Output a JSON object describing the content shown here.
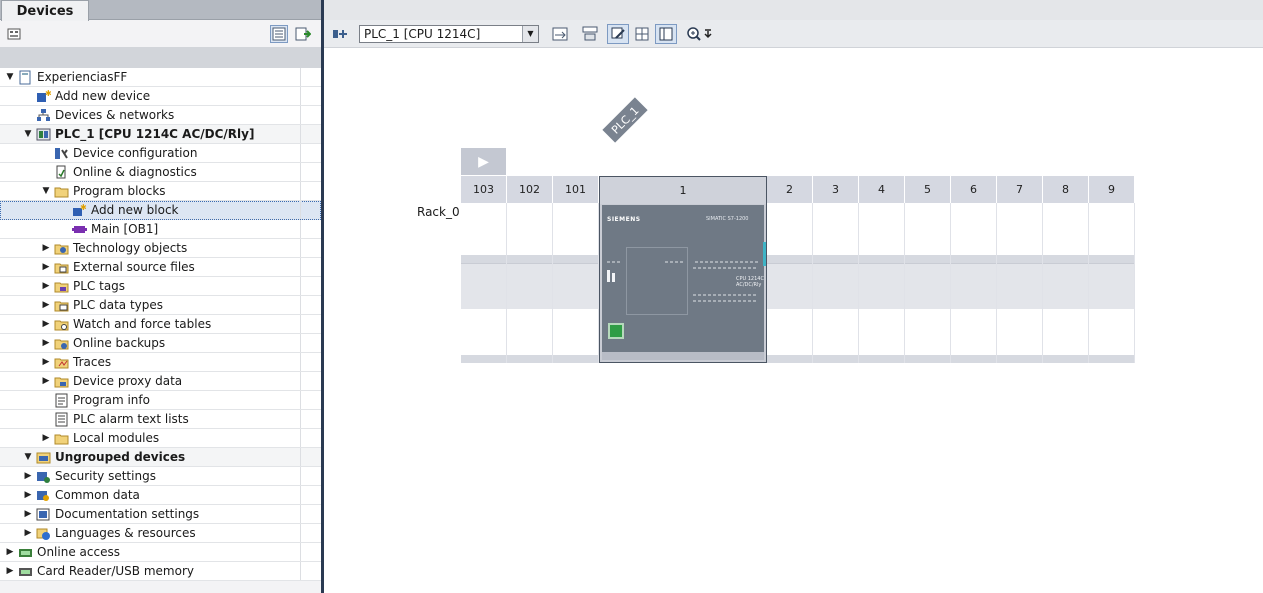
{
  "left_pane": {
    "tab_label": "Devices",
    "tree": [
      {
        "label": "ExperienciasFF",
        "indent": 0,
        "expander": "open",
        "icon": "project-icon",
        "bold": false
      },
      {
        "label": "Add new device",
        "indent": 1,
        "expander": "none",
        "icon": "add-device-icon",
        "bold": false
      },
      {
        "label": "Devices & networks",
        "indent": 1,
        "expander": "none",
        "icon": "network-icon",
        "bold": false
      },
      {
        "label": "PLC_1 [CPU 1214C AC/DC/Rly]",
        "indent": 1,
        "expander": "open",
        "icon": "plc-icon",
        "bold": true
      },
      {
        "label": "Device configuration",
        "indent": 2,
        "expander": "none",
        "icon": "device-config-icon",
        "bold": false
      },
      {
        "label": "Online & diagnostics",
        "indent": 2,
        "expander": "none",
        "icon": "diagnostics-icon",
        "bold": false
      },
      {
        "label": "Program blocks",
        "indent": 2,
        "expander": "open",
        "icon": "folder-icon",
        "bold": false
      },
      {
        "label": "Add new block",
        "indent": 3,
        "expander": "none",
        "icon": "add-block-icon",
        "bold": false,
        "selected": true
      },
      {
        "label": "Main [OB1]",
        "indent": 3,
        "expander": "none",
        "icon": "ob-block-icon",
        "bold": false
      },
      {
        "label": "Technology objects",
        "indent": 2,
        "expander": "closed",
        "icon": "technology-icon",
        "bold": false
      },
      {
        "label": "External source files",
        "indent": 2,
        "expander": "closed",
        "icon": "source-files-icon",
        "bold": false
      },
      {
        "label": "PLC tags",
        "indent": 2,
        "expander": "closed",
        "icon": "tags-icon",
        "bold": false
      },
      {
        "label": "PLC data types",
        "indent": 2,
        "expander": "closed",
        "icon": "data-types-icon",
        "bold": false
      },
      {
        "label": "Watch and force tables",
        "indent": 2,
        "expander": "closed",
        "icon": "watch-table-icon",
        "bold": false
      },
      {
        "label": "Online backups",
        "indent": 2,
        "expander": "closed",
        "icon": "backup-icon",
        "bold": false
      },
      {
        "label": "Traces",
        "indent": 2,
        "expander": "closed",
        "icon": "traces-icon",
        "bold": false
      },
      {
        "label": "Device proxy data",
        "indent": 2,
        "expander": "closed",
        "icon": "proxy-icon",
        "bold": false
      },
      {
        "label": "Program info",
        "indent": 2,
        "expander": "none",
        "icon": "program-info-icon",
        "bold": false
      },
      {
        "label": "PLC alarm text lists",
        "indent": 2,
        "expander": "none",
        "icon": "alarm-list-icon",
        "bold": false
      },
      {
        "label": "Local modules",
        "indent": 2,
        "expander": "closed",
        "icon": "folder-icon",
        "bold": false
      },
      {
        "label": "Ungrouped devices",
        "indent": 1,
        "expander": "open",
        "icon": "ungrouped-icon",
        "bold": true
      },
      {
        "label": "Security settings",
        "indent": 1,
        "expander": "closed",
        "icon": "security-icon",
        "bold": false
      },
      {
        "label": "Common data",
        "indent": 1,
        "expander": "closed",
        "icon": "common-data-icon",
        "bold": false
      },
      {
        "label": "Documentation settings",
        "indent": 1,
        "expander": "closed",
        "icon": "documentation-icon",
        "bold": false
      },
      {
        "label": "Languages & resources",
        "indent": 1,
        "expander": "closed",
        "icon": "languages-icon",
        "bold": false
      },
      {
        "label": "Online access",
        "indent": 0,
        "expander": "closed",
        "icon": "online-access-icon",
        "bold": false
      },
      {
        "label": "Card Reader/USB memory",
        "indent": 0,
        "expander": "closed",
        "icon": "card-reader-icon",
        "bold": false
      }
    ]
  },
  "right_pane": {
    "device_select_value": "PLC_1 [CPU 1214C]",
    "canvas": {
      "plc_tag": "PLC_1",
      "rack_label": "Rack_0",
      "slots": [
        "103",
        "102",
        "101",
        "1",
        "2",
        "3",
        "4",
        "5",
        "6",
        "7",
        "8",
        "9"
      ]
    },
    "cpu_module": {
      "brand": "SIEMENS",
      "family": "SIMATIC S7-1200",
      "model_line1": "CPU 1214C",
      "model_line2": "AC/DC/Rly"
    }
  },
  "colors": {
    "tab_bar": "#b4b9c1",
    "pane_divider": "#2a3a52",
    "selection": "#dde6f3",
    "slot_header": "#d5d8e1",
    "cpu_body": "#6f7985",
    "ethernet_port": "#2f9d45"
  }
}
